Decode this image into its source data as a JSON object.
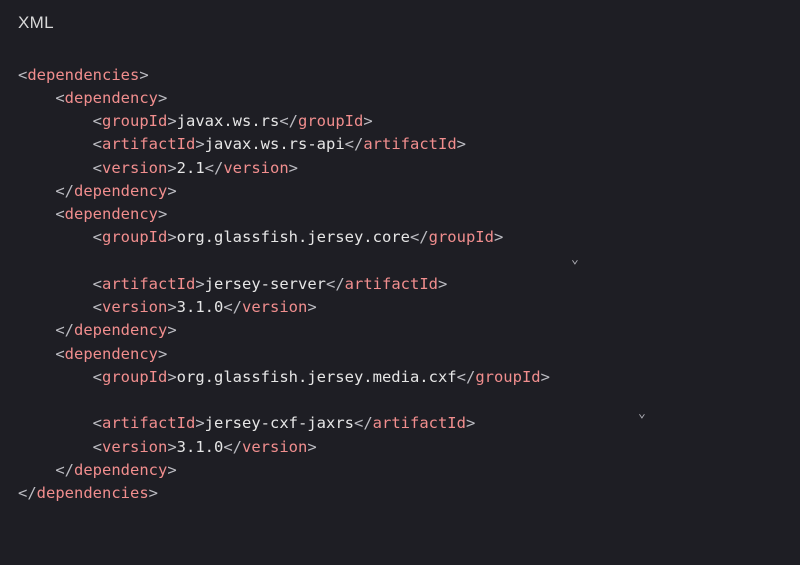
{
  "header": {
    "language_label": "XML"
  },
  "tags": {
    "dependencies": "dependencies",
    "dependency": "dependency",
    "groupId": "groupId",
    "artifactId": "artifactId",
    "version": "version"
  },
  "deps": [
    {
      "groupId": "javax.ws.rs",
      "artifactId": "javax.ws.rs-api",
      "version": "2.1"
    },
    {
      "groupId": "org.glassfish.jersey.core",
      "artifactId": "jersey-server",
      "version": "3.1.0"
    },
    {
      "groupId": "org.glassfish.jersey.media.cxf",
      "artifactId": "jersey-cxf-jaxrs",
      "version": "3.1.0"
    }
  ],
  "chevron_glyph": "⌄"
}
